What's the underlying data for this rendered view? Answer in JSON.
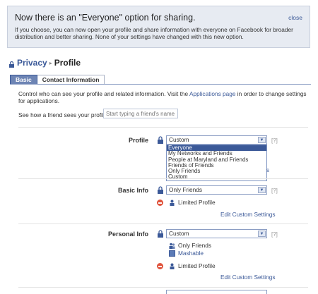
{
  "notice": {
    "title": "Now there is an \"Everyone\" option for sharing.",
    "close_label": "close",
    "body": "If you choose, you can now open your profile and share information with everyone on Facebook for broader distribution and better sharing. None of your settings have changed with this new option."
  },
  "breadcrumb": {
    "privacy": "Privacy",
    "separator": "▸",
    "current": "Profile"
  },
  "tabs": [
    {
      "label": "Basic",
      "active": true
    },
    {
      "label": "Contact Information",
      "active": false
    }
  ],
  "intro": {
    "before": "Control who can see your profile and related information. Visit the ",
    "link": "Applications page",
    "after": " in order to change settings for applications."
  },
  "see_how": {
    "label": "See how a friend sees your profile:",
    "placeholder": "Start typing a friend's name"
  },
  "help_label": "[?]",
  "edit_label": "Edit Custom Settings",
  "settings": {
    "profile": {
      "label": "Profile",
      "value": "Custom",
      "options": [
        "Everyone",
        "My Networks and Friends",
        "People at Maryland and Friends",
        "Friends of Friends",
        "Only Friends",
        "Custom"
      ],
      "highlighted": "Everyone",
      "tail_text": "s"
    },
    "basic_info": {
      "label": "Basic Info",
      "value": "Only Friends",
      "limited": "Limited Profile"
    },
    "personal_info": {
      "label": "Personal Info",
      "value": "Custom",
      "allowed": [
        "Only Friends",
        "Mashable"
      ],
      "limited": "Limited Profile"
    }
  },
  "colors": {
    "accent": "#3b5998",
    "notice_bg": "#e7ebf2",
    "tab_active": "#6d84b4",
    "deny": "#e0533c"
  }
}
